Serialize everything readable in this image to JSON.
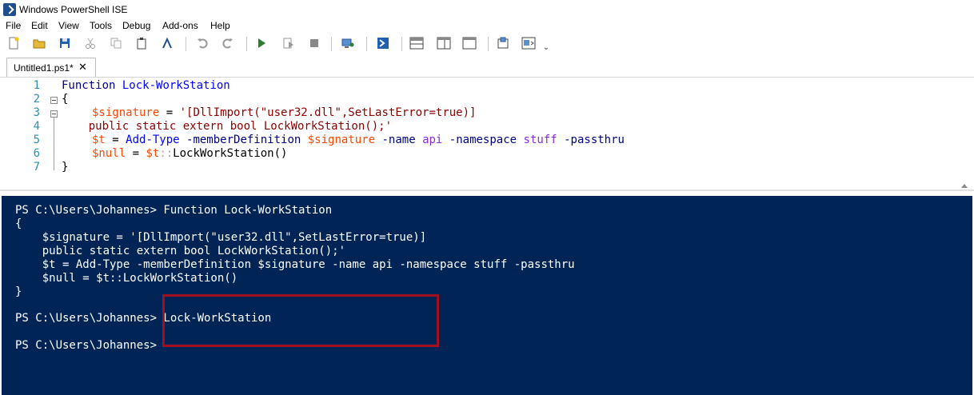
{
  "window": {
    "title": "Windows PowerShell ISE"
  },
  "menu": [
    "File",
    "Edit",
    "View",
    "Tools",
    "Debug",
    "Add-ons",
    "Help"
  ],
  "toolbar": {
    "buttons": [
      "new-script",
      "open",
      "save",
      "cut",
      "copy",
      "paste",
      "clear-console",
      "undo",
      "redo",
      "run-script",
      "run-selection",
      "stop",
      "new-remote-tab",
      "start-powershell",
      "show-script-top",
      "show-script-right",
      "show-script-max",
      "show-command-window",
      "show-command-addon"
    ],
    "overflow": "⌄"
  },
  "tabs": [
    {
      "label": "Untitled1.ps1*",
      "close": "✕"
    }
  ],
  "editor": {
    "line_numbers": [
      "1",
      "2",
      "3",
      "4",
      "5",
      "6",
      "7"
    ],
    "lines": {
      "l1": {
        "kw": "Function",
        "name": "Lock-WorkStation"
      },
      "l2": {
        "brace": "{"
      },
      "l3": {
        "var": "$signature",
        "eq": " = ",
        "str": "'[DllImport(\"user32.dll\",SetLastError=true)]"
      },
      "l4": {
        "str": "    public static extern bool LockWorkStation();'"
      },
      "l5": {
        "var": "$t",
        "eq": " = ",
        "cmd": "Add-Type",
        "p1": " -memberDefinition ",
        "v2": "$signature",
        "p2": " -name ",
        "a1": "api",
        "p3": " -namespace ",
        "a2": "stuff",
        "p4": " -passthru"
      },
      "l6": {
        "var": "$null",
        "eq": " = ",
        "v2": "$t",
        "op": "::",
        "call": "LockWorkStation()"
      },
      "l7": {
        "brace": "}"
      }
    }
  },
  "console": {
    "lines": [
      "PS C:\\Users\\Johannes> Function Lock-WorkStation",
      "{",
      "    $signature = '[DllImport(\"user32.dll\",SetLastError=true)]",
      "    public static extern bool LockWorkStation();'",
      "    $t = Add-Type -memberDefinition $signature -name api -namespace stuff -passthru",
      "    $null = $t::LockWorkStation()",
      "}",
      "",
      "PS C:\\Users\\Johannes> Lock-WorkStation",
      "",
      "PS C:\\Users\\Johannes>"
    ]
  },
  "colors": {
    "console_bg": "#012456",
    "highlight": "#a0101e",
    "line_number": "#2b91af"
  }
}
